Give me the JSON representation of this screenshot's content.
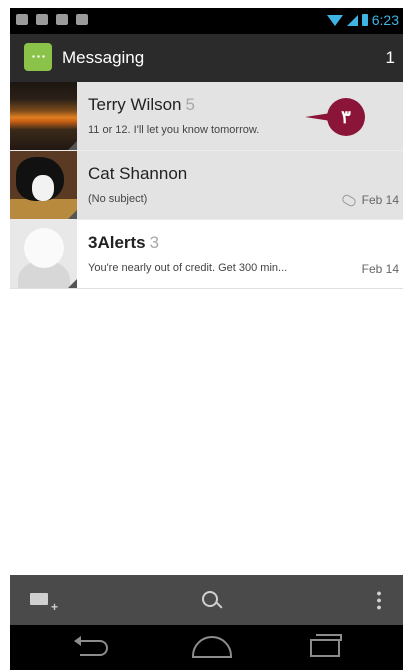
{
  "status_bar": {
    "time": "6:23"
  },
  "action_bar": {
    "title": "Messaging",
    "unread_count": "1"
  },
  "conversations": [
    {
      "name": "Terry Wilson",
      "count": "5",
      "snippet": "11 or 12. I'll let you know tomorrow.",
      "date": "",
      "avatar": "sunset-photo"
    },
    {
      "name": "Cat Shannon",
      "count": "",
      "snippet": "(No subject)",
      "date": "Feb 14",
      "avatar": "cat-photo",
      "attachment_icon": "paperclip-icon"
    },
    {
      "name": "3Alerts",
      "count": "3",
      "snippet": "You're nearly out of credit. Get 300 min...",
      "date": "Feb 14",
      "avatar": "default-contact"
    }
  ],
  "annotation": {
    "label": "٣",
    "color": "#8a1538"
  },
  "bottom_bar": {
    "icons": [
      "compose-icon",
      "search-icon",
      "overflow-menu-icon"
    ]
  },
  "nav_bar": {
    "icons": [
      "back-icon",
      "home-icon",
      "recent-apps-icon"
    ]
  },
  "colors": {
    "accent": "#3fb5e6",
    "action_bar": "#2b2b2b",
    "bottom_bar": "#4a4a4a"
  }
}
